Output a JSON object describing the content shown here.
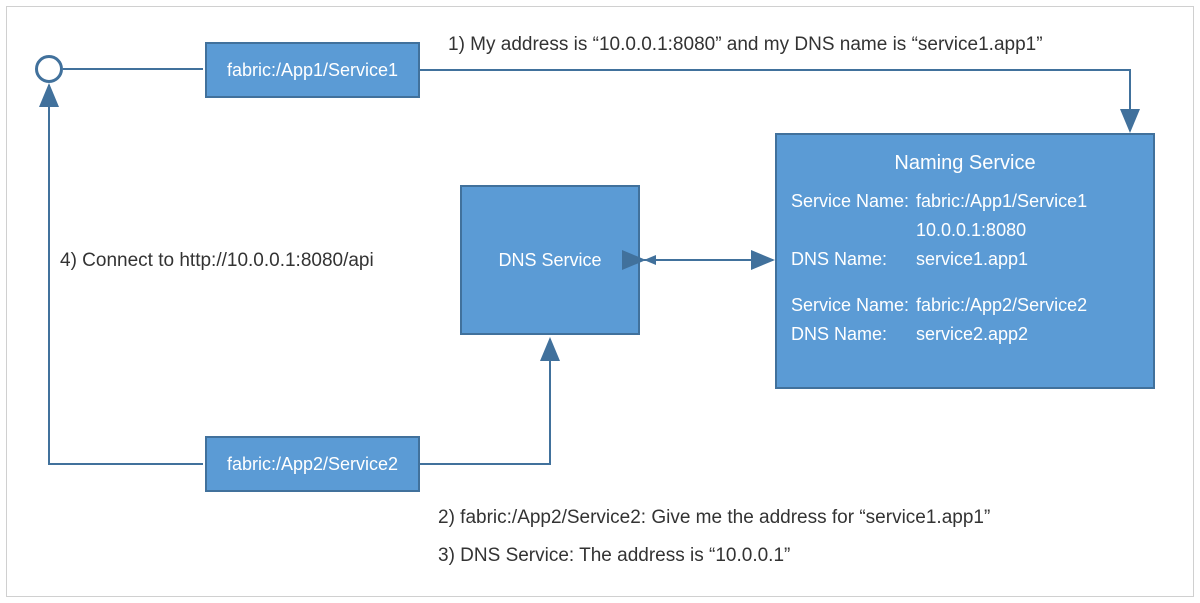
{
  "colors": {
    "boxFill": "#5b9bd5",
    "boxBorder": "#41719c",
    "arrow": "#41719c",
    "text": "#333333"
  },
  "nodes": {
    "service1": {
      "label": "fabric:/App1/Service1"
    },
    "service2": {
      "label": "fabric:/App2/Service2"
    },
    "dns": {
      "label": "DNS Service"
    },
    "naming": {
      "title": "Naming Service",
      "rows": [
        {
          "lbl": "Service Name:",
          "val": "fabric:/App1/Service1"
        },
        {
          "lbl": "",
          "val": "10.0.0.1:8080"
        },
        {
          "lbl": "DNS Name:",
          "val": "service1.app1"
        },
        {
          "lbl": "",
          "val": ""
        },
        {
          "lbl": "Service Name:",
          "val": "fabric:/App2/Service2"
        },
        {
          "lbl": "DNS Name:",
          "val": "service2.app2"
        }
      ]
    }
  },
  "annotations": {
    "step1": "1) My address is “10.0.0.1:8080” and my DNS name is “service1.app1”",
    "step2": "2) fabric:/App2/Service2: Give me the address for “service1.app1”",
    "step3": "3) DNS Service: The address is “10.0.0.1”",
    "step4": "4) Connect to http://10.0.0.1:8080/api"
  }
}
